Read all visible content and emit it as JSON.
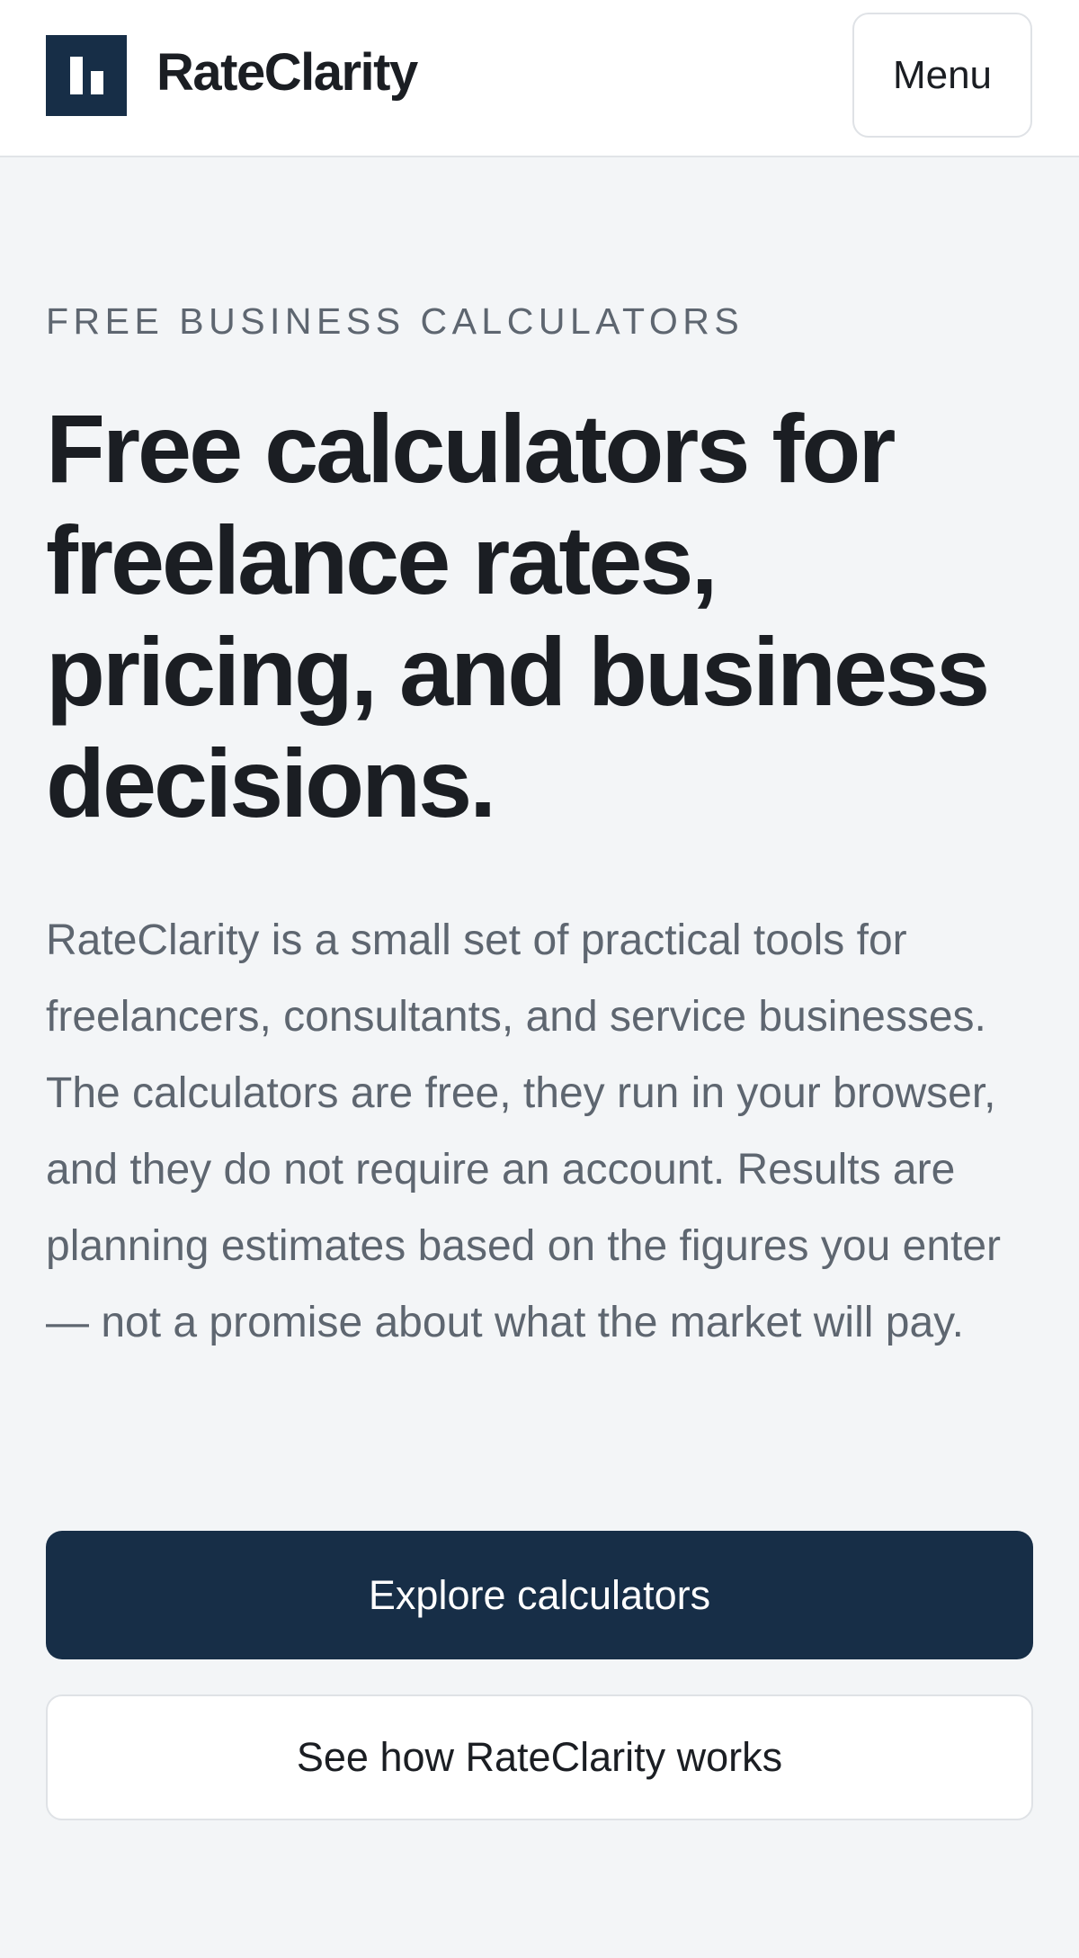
{
  "header": {
    "brand_name": "RateClarity",
    "logo_icon": "bar-chart-logo-icon",
    "menu_label": "Menu"
  },
  "hero": {
    "eyebrow": "FREE BUSINESS CALCULATORS",
    "headline": "Free calculators for freelance rates, pricing, and business decisions.",
    "intro": "RateClarity is a small set of practical tools for freelancers, consultants, and service businesses. The calculators are free, they run in your browser, and they do not require an account. Results are planning estimates based on the figures you enter — not a promise about what the market will pay.",
    "primary_cta": "Explore calculators",
    "secondary_cta": "See how RateClarity works"
  },
  "colors": {
    "brand_navy": "#172e47",
    "page_background": "#f3f5f7",
    "muted_text": "#5e6670"
  }
}
